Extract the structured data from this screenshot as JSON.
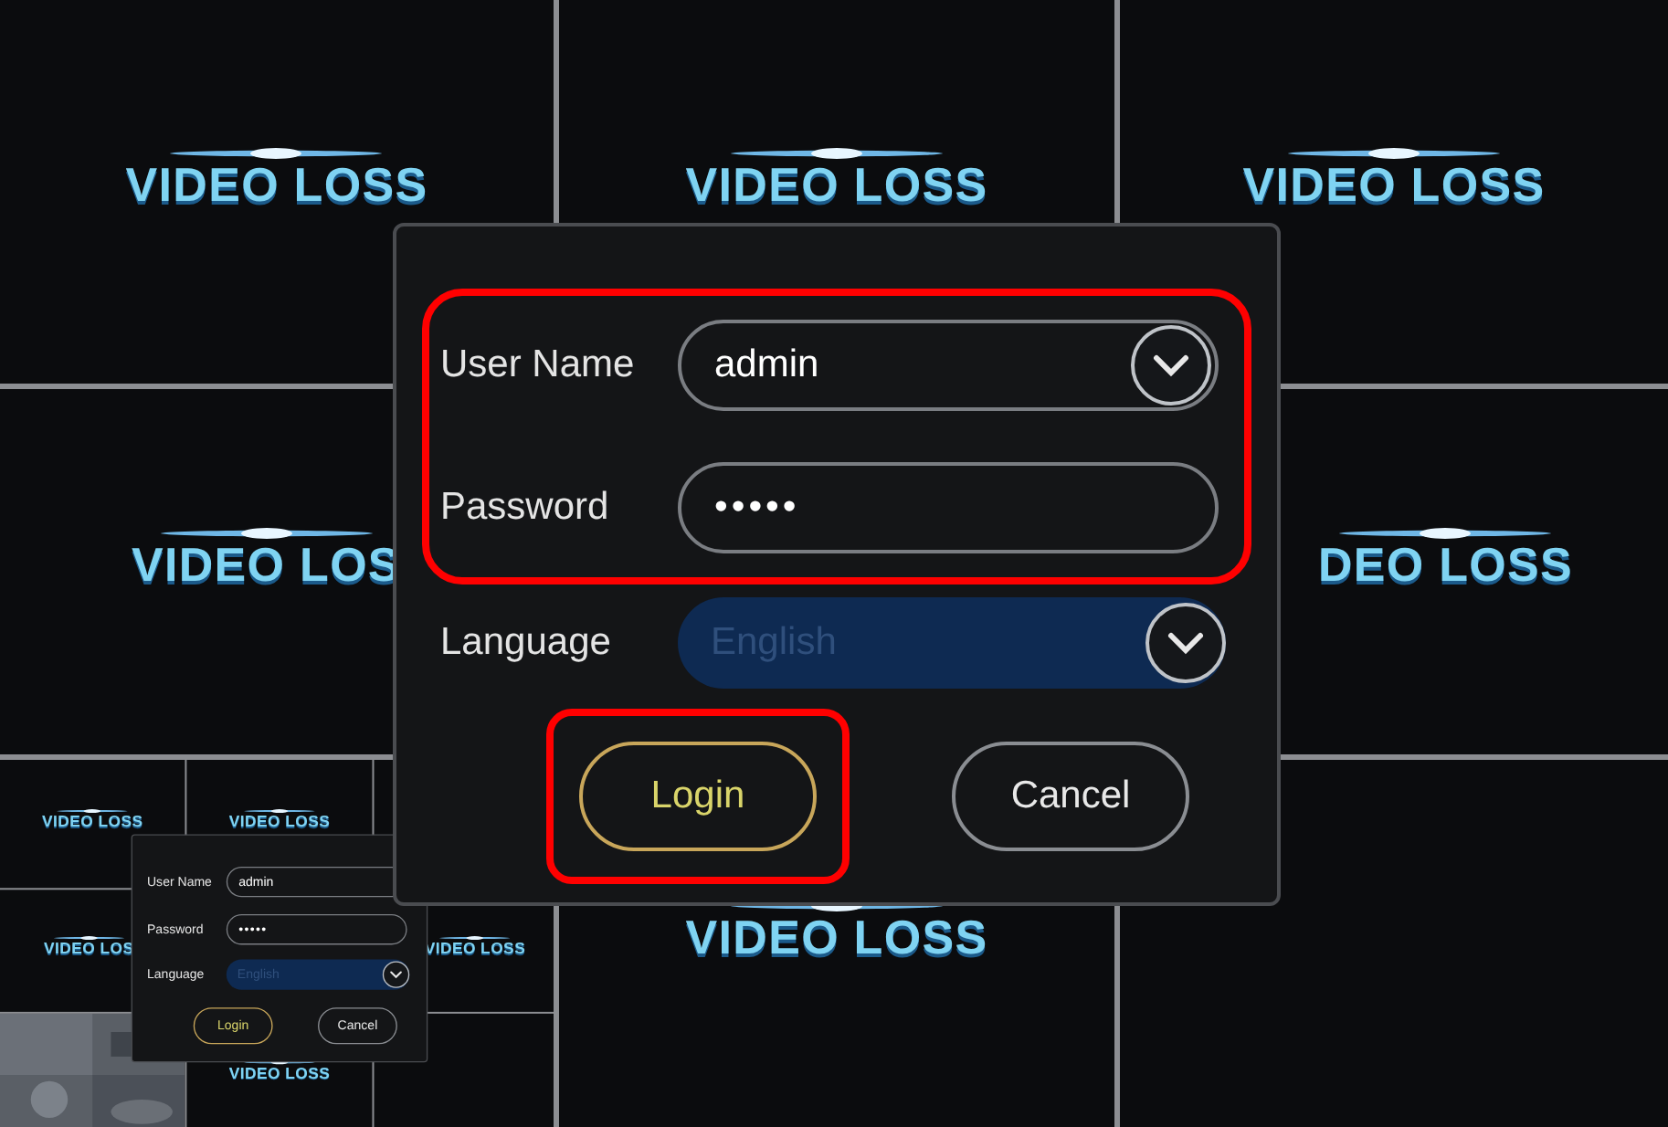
{
  "screen": {
    "tiles": [
      {
        "kind": "full",
        "text": "VIDEO LOSS"
      },
      {
        "kind": "full",
        "text": "VIDEO LOSS"
      },
      {
        "kind": "full",
        "text": "VIDEO LOSS"
      },
      {
        "kind": "cut-right",
        "text": "VIDEO LOS"
      },
      {
        "kind": "covered"
      },
      {
        "kind": "cut-left",
        "text": "DEO LOSS"
      },
      {
        "kind": "inset"
      },
      {
        "kind": "full",
        "text": "VIDEO LOSS"
      },
      {
        "kind": "blank"
      }
    ],
    "dialog": {
      "highlighted": true,
      "fields": [
        {
          "kind": "dropdown",
          "label": "User Name",
          "value": "admin",
          "disabled": false
        },
        {
          "kind": "password",
          "label": "Password",
          "value": "•••••",
          "disabled": false
        }
      ],
      "language": {
        "label": "Language",
        "value": "English",
        "disabled": true
      },
      "buttons": [
        {
          "label": "Login",
          "selected": true,
          "highlighted": true
        },
        {
          "label": "Cancel",
          "selected": false,
          "highlighted": false
        }
      ]
    }
  },
  "inset": {
    "tiles": [
      {
        "kind": "full",
        "text": "VIDEO LOSS"
      },
      {
        "kind": "full",
        "text": "VIDEO LOSS"
      },
      {
        "kind": "blank"
      },
      {
        "kind": "cut-right",
        "text": "VIDEO LOS"
      },
      {
        "kind": "covered"
      },
      {
        "kind": "cut-left",
        "text": "VIDEO LOSS"
      },
      {
        "kind": "picture"
      },
      {
        "kind": "full",
        "text": "VIDEO LOSS"
      },
      {
        "kind": "blank"
      }
    ],
    "dialog": {
      "highlighted": false,
      "fields": [
        {
          "kind": "text",
          "label": "User Name",
          "value": "admin",
          "disabled": false
        },
        {
          "kind": "password",
          "label": "Password",
          "value": "•••••",
          "disabled": false
        }
      ],
      "language": {
        "label": "Language",
        "value": "English",
        "disabled": true
      },
      "buttons": [
        {
          "label": "Login",
          "selected": true,
          "highlighted": false
        },
        {
          "label": "Cancel",
          "selected": false,
          "highlighted": false
        }
      ]
    }
  }
}
